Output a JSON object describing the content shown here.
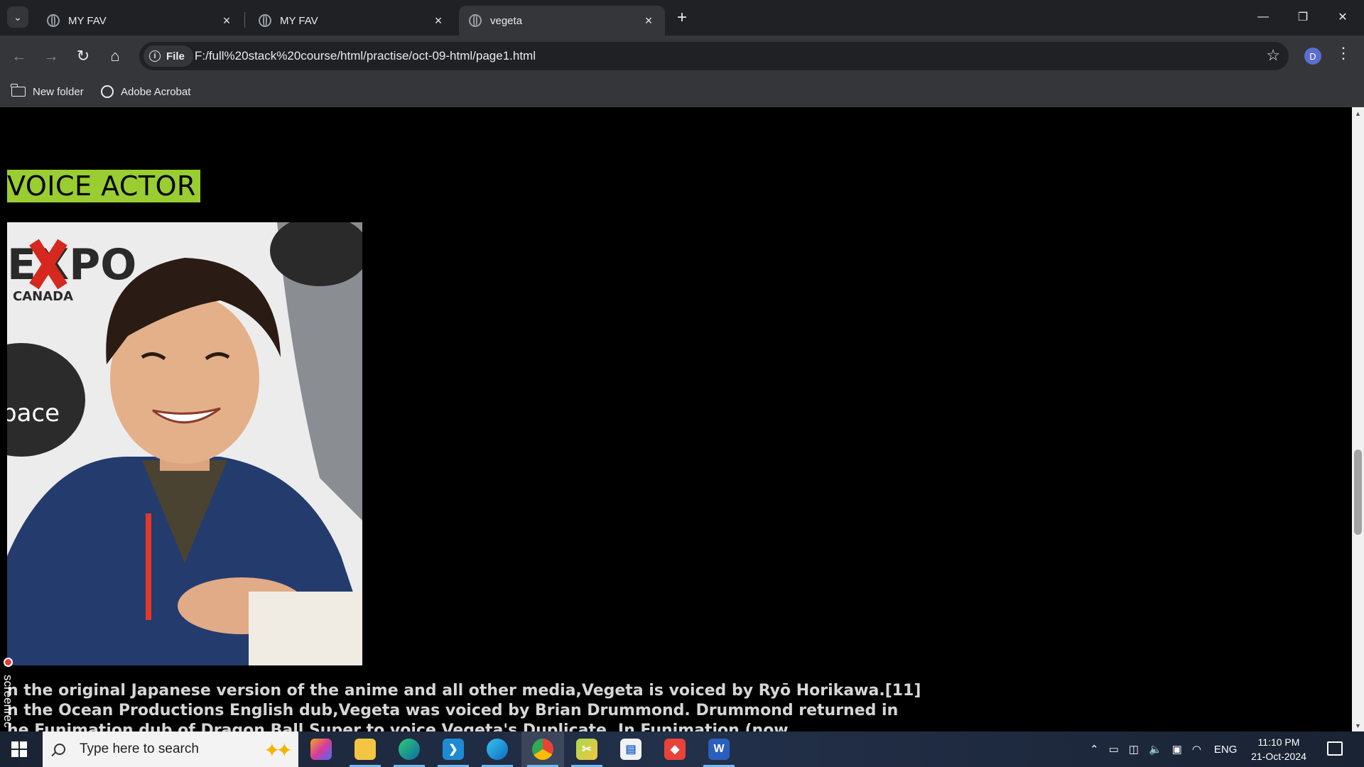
{
  "browser": {
    "tabs": [
      {
        "title": "MY FAV",
        "active": false
      },
      {
        "title": "MY FAV",
        "active": false
      },
      {
        "title": "vegeta",
        "active": true
      }
    ],
    "site_info_label": "File",
    "url": "F:/full%20stack%20course/html/practise/oct-09-html/page1.html",
    "profile_initial": "D",
    "bookmarks": [
      {
        "label": "New folder",
        "icon": "folder-icon"
      },
      {
        "label": "Adobe Acrobat",
        "icon": "globe-icon"
      }
    ]
  },
  "page": {
    "heading": "VOICE ACTOR",
    "heading_bg": "#9acd32",
    "photo_text": {
      "brand": "EXPO",
      "country": "CANADA",
      "partial": "pace"
    },
    "paragraph_lines": [
      "n the original Japanese version of the anime and all other media,Vegeta is voiced by Ryō Horikawa.[11]",
      "n the Ocean Productions English dub,Vegeta was voiced by Brian Drummond. Drummond returned in",
      "he Funimation dub of Dragon Ball Super to voice Vegeta's Duplicate. In Funimation (now"
    ]
  },
  "overlay": {
    "recorder_label": "screenrec"
  },
  "taskbar": {
    "search_placeholder": "Type here to search",
    "apps": [
      {
        "name": "copilot",
        "icon": "copilot-icon"
      },
      {
        "name": "file-explorer",
        "icon": "folder-icon"
      },
      {
        "name": "edge-dev",
        "icon": "edge-icon"
      },
      {
        "name": "vscode",
        "icon": "vscode-icon"
      },
      {
        "name": "edge",
        "icon": "edge-icon"
      },
      {
        "name": "chrome",
        "icon": "chrome-icon"
      },
      {
        "name": "snipping-tool",
        "icon": "snip-icon"
      },
      {
        "name": "file-manager",
        "icon": "file-icon"
      },
      {
        "name": "anydesk",
        "icon": "anydesk-icon"
      },
      {
        "name": "word",
        "icon": "word-icon"
      }
    ],
    "language": "ENG",
    "time": "11:10 PM",
    "date": "21-Oct-2024"
  }
}
